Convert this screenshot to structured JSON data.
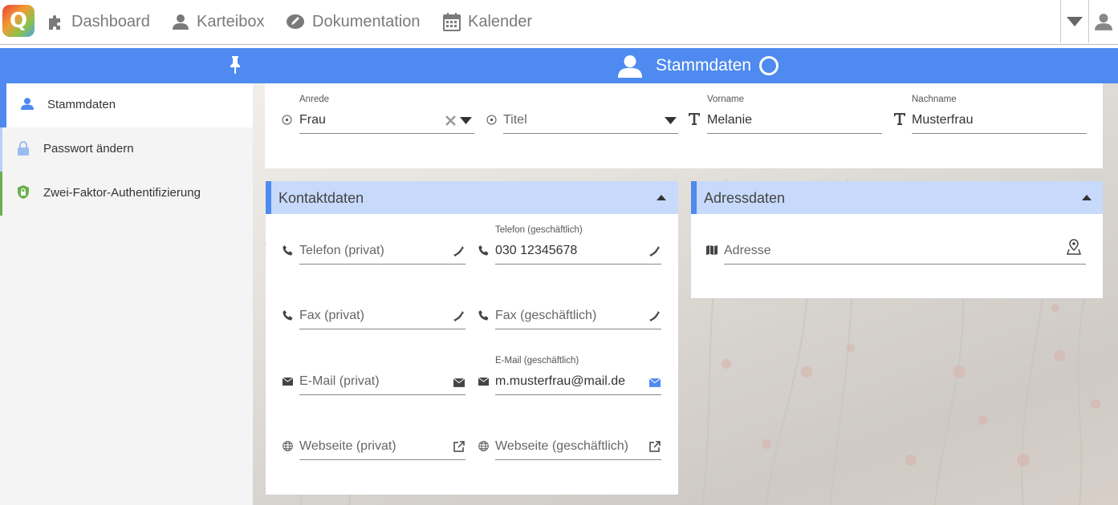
{
  "app": {
    "logo_letter": "Q"
  },
  "nav": {
    "items": [
      {
        "label": "Dashboard",
        "icon": "puzzle-icon"
      },
      {
        "label": "Karteibox",
        "icon": "user-icon"
      },
      {
        "label": "Dokumentation",
        "icon": "pencil-icon"
      },
      {
        "label": "Kalender",
        "icon": "calendar-icon"
      }
    ]
  },
  "header": {
    "title": "Stammdaten"
  },
  "sidebar": {
    "items": [
      {
        "label": "Stammdaten",
        "icon": "user-icon",
        "active": true
      },
      {
        "label": "Passwort ändern",
        "icon": "lock-icon"
      },
      {
        "label": "Zwei-Faktor-Authentifizierung",
        "icon": "shield-icon"
      }
    ]
  },
  "personal": {
    "anrede": {
      "label": "Anrede",
      "value": "Frau"
    },
    "titel": {
      "placeholder": "Titel"
    },
    "vorname": {
      "label": "Vorname",
      "value": "Melanie"
    },
    "nachname": {
      "label": "Nachname",
      "value": "Musterfrau"
    }
  },
  "kontakt": {
    "title": "Kontaktdaten",
    "telefon_privat": {
      "placeholder": "Telefon (privat)"
    },
    "telefon_geschaeftlich": {
      "label": "Telefon (geschäftlich)",
      "value": "030 12345678"
    },
    "fax_privat": {
      "placeholder": "Fax (privat)"
    },
    "fax_geschaeftlich": {
      "placeholder": "Fax (geschäftlich)"
    },
    "email_privat": {
      "placeholder": "E-Mail (privat)"
    },
    "email_geschaeftlich": {
      "label": "E-Mail (geschäftlich)",
      "value": "m.musterfrau@mail.de"
    },
    "webseite_privat": {
      "placeholder": "Webseite (privat)"
    },
    "webseite_geschaeftlich": {
      "placeholder": "Webseite (geschäftlich)"
    }
  },
  "adresse": {
    "title": "Adressdaten",
    "adresse": {
      "placeholder": "Adresse"
    }
  },
  "colors": {
    "accent": "#4e8af0",
    "section_header": "#c7dafc",
    "sidebar_bg": "#f4f4f4"
  }
}
